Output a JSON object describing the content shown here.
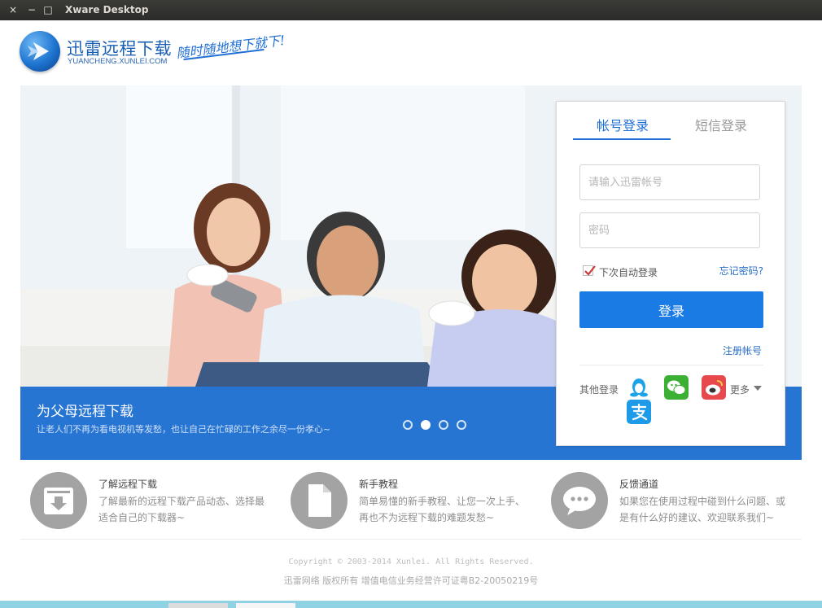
{
  "window": {
    "title": "Xware Desktop",
    "controls": [
      "×",
      "−",
      "□"
    ]
  },
  "header": {
    "logo_text": "迅雷远程下载",
    "logo_url_text": "YUANCHENG.XUNLEI.COM",
    "slogan": "随时随地想下就下!"
  },
  "banner": {
    "title": "为父母远程下载",
    "subtitle": "让老人们不再为看电视机等发愁，也让自己在忙碌的工作之余尽一份孝心~",
    "slide_count": 4,
    "active_slide": 2
  },
  "login": {
    "tabs": [
      {
        "label": "帐号登录",
        "active": true
      },
      {
        "label": "短信登录",
        "active": false
      }
    ],
    "account_placeholder": "请输入迅雷帐号",
    "password_placeholder": "密码",
    "auto_login_label": "下次自动登录",
    "auto_login_checked": true,
    "forgot_label": "忘记密码?",
    "login_button": "登录",
    "register_label": "注册帐号",
    "other_login_label": "其他登录",
    "more_label": "更多",
    "social": [
      {
        "name": "qq",
        "icon": "qq-penguin-icon",
        "color": "#1aa3e8"
      },
      {
        "name": "wechat",
        "icon": "wechat-icon",
        "color": "#3cb034"
      },
      {
        "name": "weibo",
        "icon": "weibo-icon",
        "color": "#e6484d"
      },
      {
        "name": "alipay",
        "icon": "alipay-icon",
        "color": "#1e9be8"
      }
    ]
  },
  "features": [
    {
      "icon": "download-box-icon",
      "title": "了解远程下载",
      "desc": "了解最新的远程下载产品动态、选择最适合自己的下载器~"
    },
    {
      "icon": "document-icon",
      "title": "新手教程",
      "desc": "简单易懂的新手教程、让您一次上手、再也不为远程下载的难题发愁~"
    },
    {
      "icon": "chat-bubble-icon",
      "title": "反馈通道",
      "desc": "如果您在使用过程中碰到什么问题、或是有什么好的建议、欢迎联系我们~"
    }
  ],
  "footer": {
    "copyright": "Copyright © 2003-2014 Xunlei. All Rights Reserved.",
    "icp": "迅雷网络 版权所有 增值电信业务经营许可证粤B2-20050219号"
  },
  "colors": {
    "accent": "#1b7be4",
    "banner": "#2775d3",
    "titlebar": "#2f2f2d"
  }
}
